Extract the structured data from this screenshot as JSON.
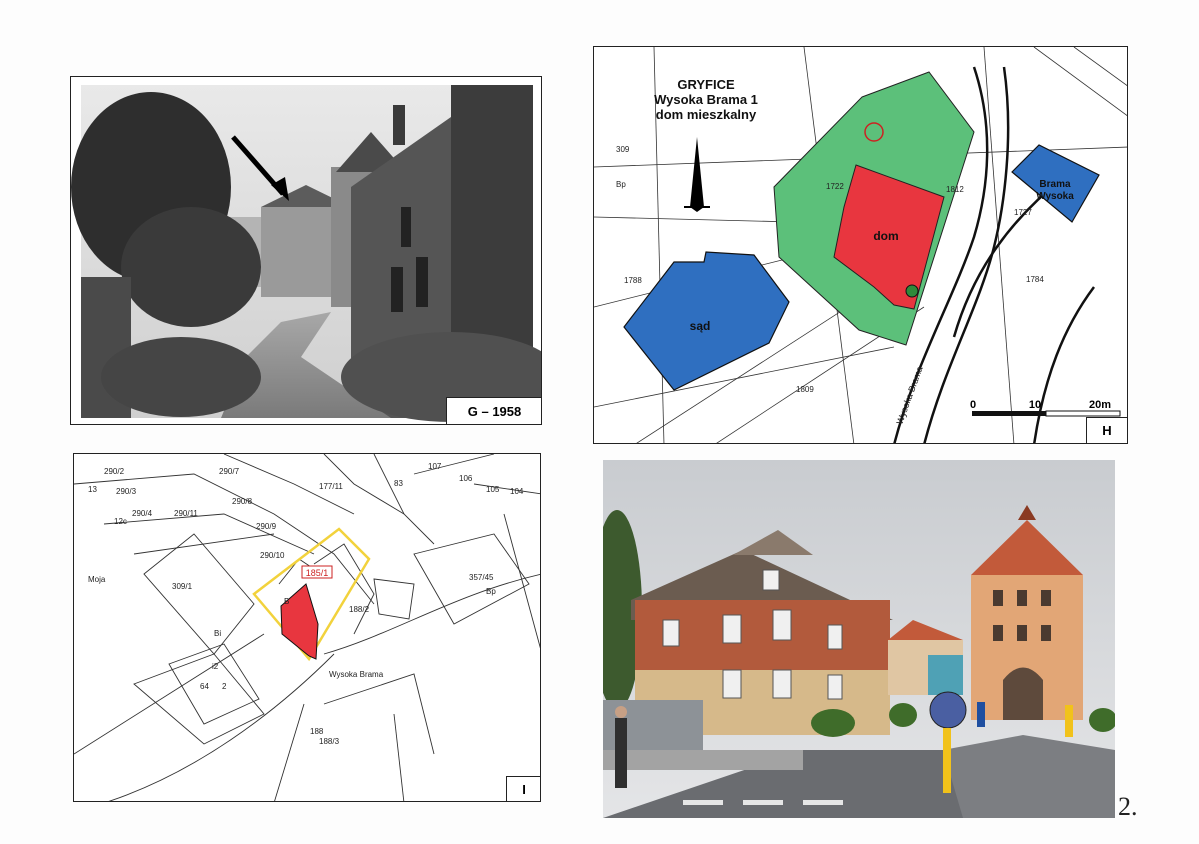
{
  "page": {
    "number": "2."
  },
  "photo_1958": {
    "label": "G – 1958"
  },
  "site_map": {
    "title_1": "GRYFICE",
    "title_2": "Wysoka Brama 1",
    "title_3": "dom mieszkalny",
    "house_label": "dom",
    "court_label": "sąd",
    "gate_label_1": "Brama",
    "gate_label_2": "Wysoka",
    "scale_0": "0",
    "scale_10": "10",
    "scale_20": "20m",
    "panel_label": "H",
    "street_label": "Wysoka Brama",
    "parcel_codes": [
      "309",
      "Bp",
      "1809",
      "1788",
      "1812",
      "1722",
      "1727",
      "1784"
    ]
  },
  "cadastral_map": {
    "panel_label": "I",
    "parcel_highlight": "185/1",
    "street_label": "Wysoka Brama",
    "parcels": [
      "290/2",
      "290/7",
      "290/8",
      "290/9",
      "290/10",
      "290/11",
      "290/3",
      "290/4",
      "177/11",
      "107",
      "105",
      "104",
      "106",
      "309/1",
      "188/2",
      "188/3",
      "357/45",
      "Bp",
      "Bi",
      "i2",
      "64",
      "2",
      "188",
      "B",
      "Moja",
      "13",
      "12c",
      "83"
    ]
  },
  "photo_modern": {},
  "colors": {
    "house": "#e8363f",
    "court": "#2f6fc0",
    "plot": "#5cc07a",
    "gate": "#2f6fc0",
    "highlight_outline": "#f2d23c"
  }
}
